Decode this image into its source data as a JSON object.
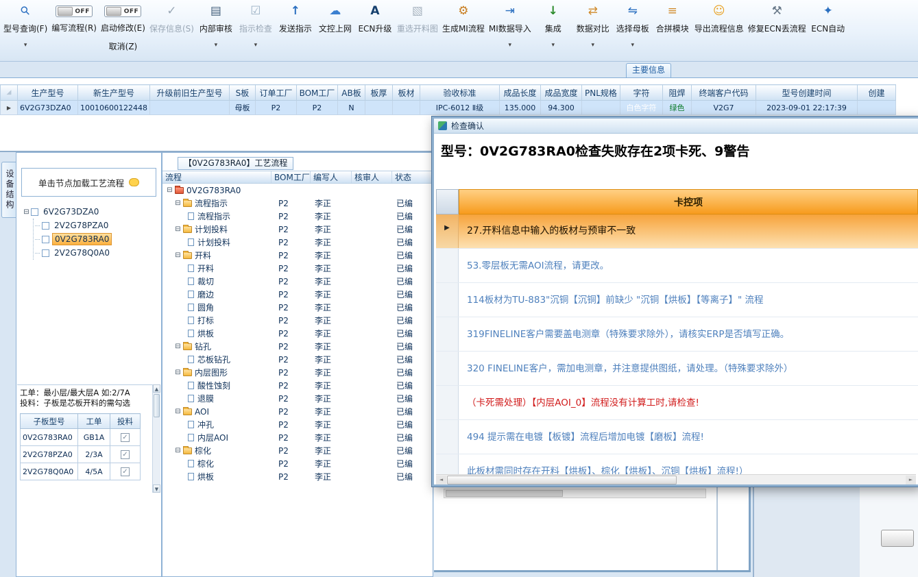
{
  "tabs": {
    "main_tab": "主要信息"
  },
  "toolbar": {
    "items": [
      {
        "name": "model-query",
        "icon": "search-icon",
        "label": "型号查询(F)",
        "dropdown": true
      },
      {
        "name": "write-flow",
        "toggle": "OFF",
        "label": "编写流程(R)"
      },
      {
        "name": "start-modify",
        "toggle": "OFF",
        "label": "启动修改(E)",
        "sublabel": "取消(Z)"
      },
      {
        "name": "save-info",
        "icon": "check-icon",
        "label": "保存信息(S)",
        "disabled": true
      },
      {
        "name": "internal-audit",
        "icon": "printer-icon",
        "label": "内部审核",
        "dropdown": true
      },
      {
        "name": "instruction-check",
        "icon": "checkbox-icon",
        "label": "指示检查",
        "disabled": true,
        "dropdown": true
      },
      {
        "name": "send-instruction",
        "icon": "upload-icon",
        "label": "发送指示"
      },
      {
        "name": "doc-control-upload",
        "icon": "cloud-icon",
        "label": "文控上网"
      },
      {
        "name": "ecn-upgrade",
        "icon": "font-icon",
        "label": "ECN升级"
      },
      {
        "name": "reselect-cutting-diagram",
        "icon": "image-icon",
        "label": "重选开料图",
        "disabled": true
      },
      {
        "name": "generate-mi-flow",
        "icon": "gear-icon",
        "label": "生成MI流程"
      },
      {
        "name": "mi-data-import",
        "icon": "import-icon",
        "label": "MI数据导入",
        "dropdown": true
      },
      {
        "name": "integrate",
        "icon": "download-icon",
        "label": "集成",
        "dropdown": true
      },
      {
        "name": "data-compare",
        "icon": "compare-icon",
        "label": "数据对比",
        "dropdown": true
      },
      {
        "name": "select-motherboard",
        "icon": "shuffle-icon",
        "label": "选择母板",
        "dropdown": true
      },
      {
        "name": "merge-module",
        "icon": "list-icon",
        "label": "合拼模块"
      },
      {
        "name": "export-flow-info",
        "icon": "smiley-icon",
        "label": "导出流程信息"
      },
      {
        "name": "repair-ecn-flow",
        "icon": "wrench-icon",
        "label": "修复ECN丢流程"
      },
      {
        "name": "ecn-auto",
        "icon": "power-icon",
        "label": "ECN自动"
      }
    ]
  },
  "grid": {
    "columns": [
      "生产型号",
      "新生产型号",
      "升级前旧生产型号",
      "S板",
      "订单工厂",
      "BOM工厂",
      "AB板",
      "板厚",
      "板材",
      "验收标准",
      "成品长度",
      "成品宽度",
      "PNL规格",
      "字符",
      "阻焊",
      "终端客户代码",
      "型号创建时间",
      "创建"
    ],
    "rows": [
      [
        "6V2G73DZA0",
        "10010600122448",
        "",
        "母板",
        "P2",
        "P2",
        "N",
        "",
        "",
        "IPC-6012 Ⅱ级",
        "135.000",
        "94.300",
        "",
        "白色字符",
        "绿色",
        "V2G7",
        "2023-09-01 22:17:39",
        ""
      ]
    ]
  },
  "left_panel": {
    "vertical_tab": "设备结构",
    "tree_header": "单击节点加载工艺流程",
    "tree": {
      "root": "6V2G73DZA0",
      "children": [
        "2V2G78PZA0",
        "0V2G783RA0",
        "2V2G78Q0A0"
      ],
      "selected": "0V2G783RA0"
    },
    "note_line1": "工单：最小层/最大层A 如:2/7A",
    "note_line2": "投料：子板是芯板开料的需勾选",
    "sub_table": {
      "columns": [
        "子板型号",
        "工单",
        "投料"
      ],
      "rows": [
        {
          "model": "0V2G783RA0",
          "order": "GB1A",
          "checked": true
        },
        {
          "model": "2V2G78PZA0",
          "order": "2/3A",
          "checked": true
        },
        {
          "model": "2V2G78Q0A0",
          "order": "4/5A",
          "checked": true
        }
      ]
    }
  },
  "flow_panel": {
    "tab": "【0V2G783RA0】工艺流程",
    "columns": [
      "流程",
      "BOM工厂",
      "编写人",
      "核审人",
      "状态"
    ],
    "root": "0V2G783RA0",
    "rows": [
      {
        "name": "流程指示",
        "type": "folder",
        "level": 1,
        "bom": "P2",
        "writer": "李正",
        "reviewer": "",
        "status": "已编"
      },
      {
        "name": "流程指示",
        "type": "doc",
        "level": 2,
        "bom": "P2",
        "writer": "李正",
        "reviewer": "",
        "status": "已编"
      },
      {
        "name": "计划投料",
        "type": "folder",
        "level": 1,
        "bom": "P2",
        "writer": "李正",
        "reviewer": "",
        "status": "已编"
      },
      {
        "name": "计划投料",
        "type": "doc",
        "level": 2,
        "bom": "P2",
        "writer": "李正",
        "reviewer": "",
        "status": "已编"
      },
      {
        "name": "开料",
        "type": "folder",
        "level": 1,
        "bom": "P2",
        "writer": "李正",
        "reviewer": "",
        "status": "已编"
      },
      {
        "name": "开料",
        "type": "doc",
        "level": 2,
        "bom": "P2",
        "writer": "李正",
        "reviewer": "",
        "status": "已编"
      },
      {
        "name": "裁切",
        "type": "doc",
        "level": 2,
        "bom": "P2",
        "writer": "李正",
        "reviewer": "",
        "status": "已编"
      },
      {
        "name": "磨边",
        "type": "doc",
        "level": 2,
        "bom": "P2",
        "writer": "李正",
        "reviewer": "",
        "status": "已编"
      },
      {
        "name": "圆角",
        "type": "doc",
        "level": 2,
        "bom": "P2",
        "writer": "李正",
        "reviewer": "",
        "status": "已编"
      },
      {
        "name": "打标",
        "type": "doc",
        "level": 2,
        "bom": "P2",
        "writer": "李正",
        "reviewer": "",
        "status": "已编"
      },
      {
        "name": "烘板",
        "type": "doc",
        "level": 2,
        "bom": "P2",
        "writer": "李正",
        "reviewer": "",
        "status": "已编"
      },
      {
        "name": "钻孔",
        "type": "folder",
        "level": 1,
        "bom": "P2",
        "writer": "李正",
        "reviewer": "",
        "status": "已编"
      },
      {
        "name": "芯板钻孔",
        "type": "doc",
        "level": 2,
        "bom": "P2",
        "writer": "李正",
        "reviewer": "",
        "status": "已编"
      },
      {
        "name": "内层图形",
        "type": "folder",
        "level": 1,
        "bom": "P2",
        "writer": "李正",
        "reviewer": "",
        "status": "已编"
      },
      {
        "name": "酸性蚀刻",
        "type": "doc",
        "level": 2,
        "bom": "P2",
        "writer": "李正",
        "reviewer": "",
        "status": "已编"
      },
      {
        "name": "退膜",
        "type": "doc",
        "level": 2,
        "bom": "P2",
        "writer": "李正",
        "reviewer": "",
        "status": "已编"
      },
      {
        "name": "AOI",
        "type": "folder",
        "level": 1,
        "bom": "P2",
        "writer": "李正",
        "reviewer": "",
        "status": "已编"
      },
      {
        "name": "冲孔",
        "type": "doc",
        "level": 2,
        "bom": "P2",
        "writer": "李正",
        "reviewer": "",
        "status": "已编"
      },
      {
        "name": "内层AOI",
        "type": "doc",
        "level": 2,
        "bom": "P2",
        "writer": "李正",
        "reviewer": "",
        "status": "已编"
      },
      {
        "name": "棕化",
        "type": "folder",
        "level": 1,
        "bom": "P2",
        "writer": "李正",
        "reviewer": "",
        "status": "已编"
      },
      {
        "name": "棕化",
        "type": "doc",
        "level": 2,
        "bom": "P2",
        "writer": "李正",
        "reviewer": "",
        "status": "已编"
      },
      {
        "name": "烘板",
        "type": "doc",
        "level": 2,
        "bom": "P2",
        "writer": "李正",
        "reviewer": "",
        "status": "已编"
      }
    ]
  },
  "dialog": {
    "title": "检查确认",
    "heading": "型号：0V2G783RA0检查失败存在2项卡死、9警告",
    "column_header": "卡控项",
    "rows": [
      {
        "style": "selected",
        "text": "27.开料信息中输入的板材与预审不一致"
      },
      {
        "style": "normal",
        "text": "53.零层板无需AOI流程，请更改。"
      },
      {
        "style": "normal",
        "text": "114板材为TU-883\"沉铜【沉铜】前缺少 \"沉铜【烘板】【等离子】\" 流程"
      },
      {
        "style": "normal",
        "text": "319FINELINE客户需要盖电测章（特殊要求除外），请核实ERP是否填写正确。"
      },
      {
        "style": "normal",
        "text": "320 FINELINE客户，需加电测章，并注意提供图纸，请处理。（特殊要求除外）"
      },
      {
        "style": "error",
        "text": "（卡死需处理）【内层AOI_0】流程没有计算工时,请检查!"
      },
      {
        "style": "normal",
        "text": "494 提示需在电镀【板镀】流程后增加电镀【磨板】流程!"
      },
      {
        "style": "normal",
        "text": "此板材需同时存在开料【烘板】、棕化【烘板】、沉铜【烘板】流程!）"
      }
    ]
  }
}
